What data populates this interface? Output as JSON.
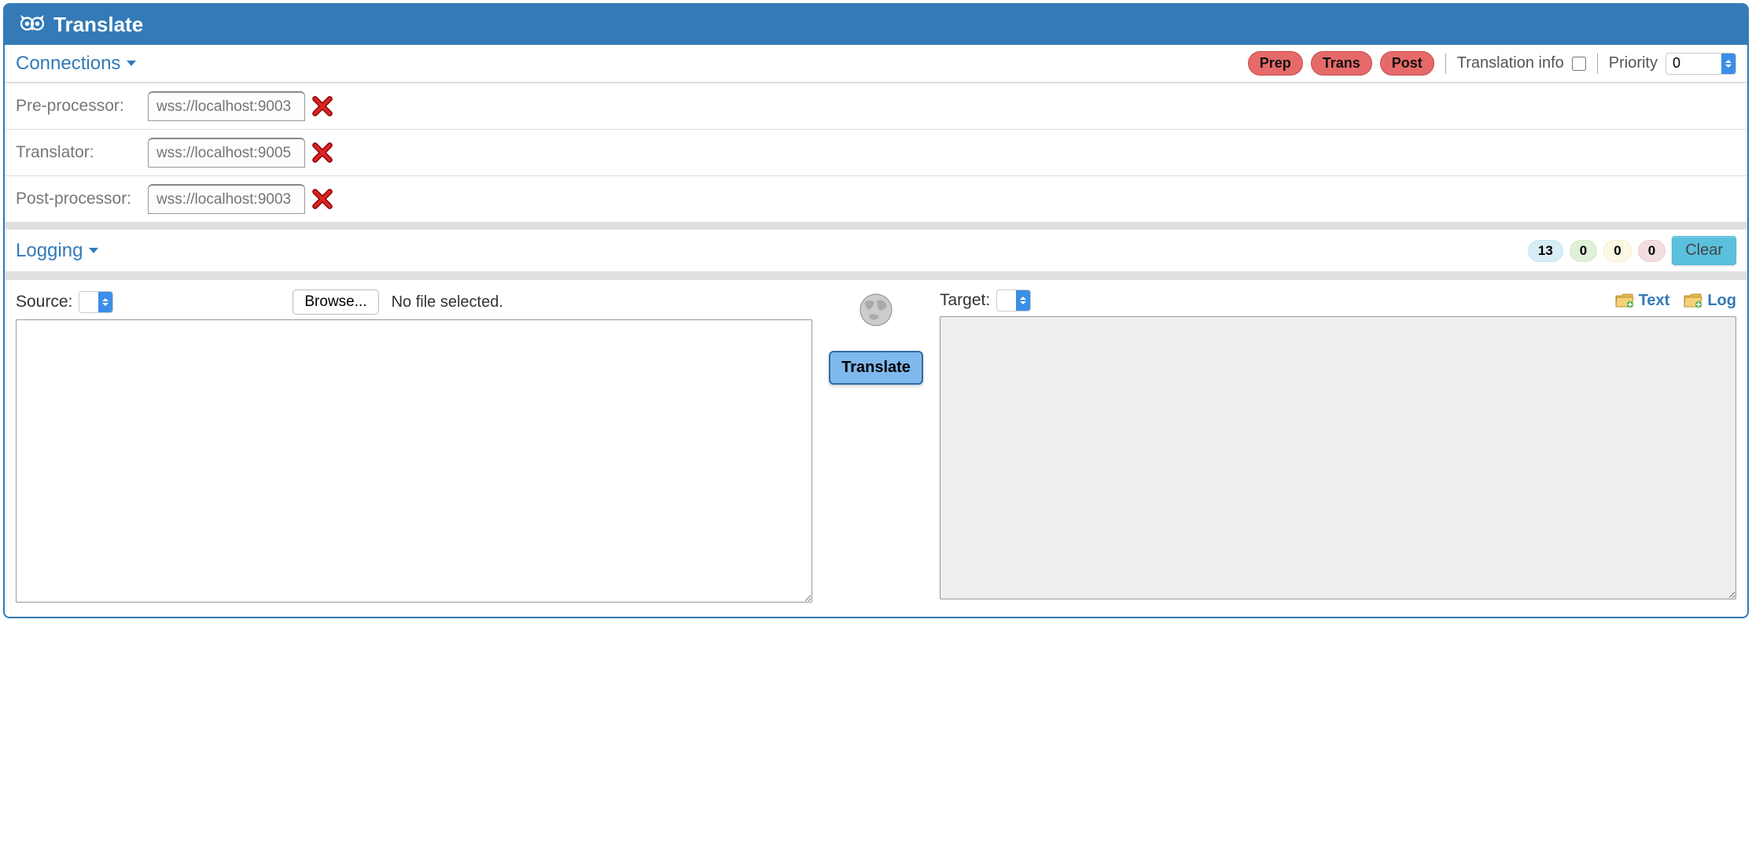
{
  "header": {
    "title": "Translate"
  },
  "connections": {
    "title": "Connections",
    "rows": [
      {
        "label": "Pre-processor:",
        "placeholder": "wss://localhost:9003"
      },
      {
        "label": "Translator:",
        "placeholder": "wss://localhost:9005"
      },
      {
        "label": "Post-processor:",
        "placeholder": "wss://localhost:9003"
      }
    ],
    "pills": {
      "prep": "Prep",
      "trans": "Trans",
      "post": "Post"
    },
    "info_label": "Translation info",
    "priority_label": "Priority",
    "priority_value": "0"
  },
  "logging": {
    "title": "Logging",
    "counts": {
      "info": "13",
      "success": "0",
      "warn": "0",
      "error": "0"
    },
    "clear": "Clear"
  },
  "main": {
    "source_label": "Source:",
    "browse": "Browse...",
    "file_status": "No file selected.",
    "translate": "Translate",
    "target_label": "Target:",
    "text_link": "Text",
    "log_link": "Log"
  }
}
